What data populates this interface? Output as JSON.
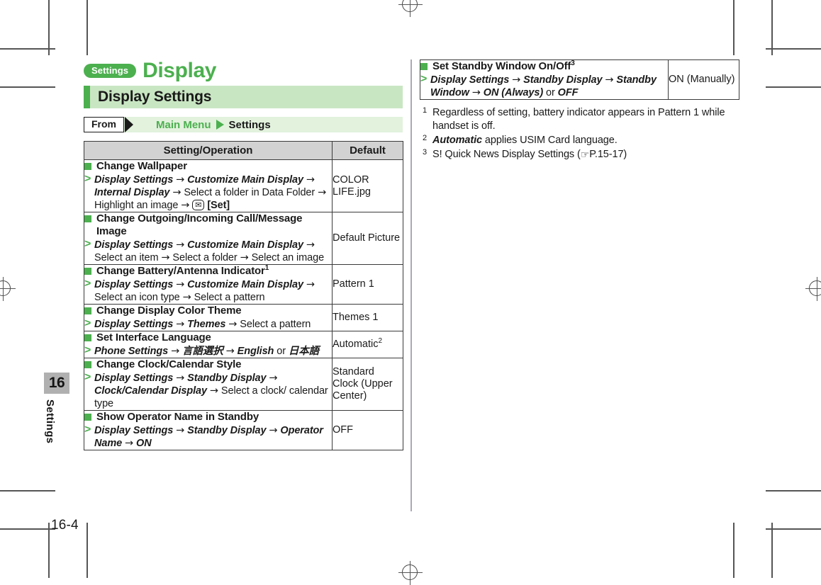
{
  "page": {
    "folio": "16-4",
    "side_tab_number": "16",
    "side_tab_label": "Settings"
  },
  "header": {
    "badge": "Settings",
    "title": "Display",
    "section_title": "Display Settings"
  },
  "breadcrumb": {
    "from_label": "From",
    "first": "Main Menu",
    "second": "Settings"
  },
  "table": {
    "columns": [
      "Setting/Operation",
      "Default"
    ],
    "rows": [
      {
        "title": "Change Wallpaper",
        "title_footnote": "",
        "steps": [
          {
            "text": "Display Settings",
            "style": "bi"
          },
          {
            "text": "→",
            "style": "arrow"
          },
          {
            "text": "Customize Main Display",
            "style": "bi"
          },
          {
            "text": "→",
            "style": "arrow"
          },
          {
            "text": "Internal Display",
            "style": "bi"
          },
          {
            "text": "→",
            "style": "arrow"
          },
          {
            "text": "Select a folder in Data Folder",
            "style": "plain"
          },
          {
            "text": "→",
            "style": "arrow"
          },
          {
            "text": "Highlight an image",
            "style": "plain"
          },
          {
            "text": "→",
            "style": "arrow"
          },
          {
            "text": "envelope-key",
            "style": "key"
          },
          {
            "text": "[Set]",
            "style": "bold"
          }
        ],
        "default": "COLOR LIFE.jpg"
      },
      {
        "title": "Change Outgoing/Incoming Call/Message Image",
        "title_footnote": "",
        "steps": [
          {
            "text": "Display Settings",
            "style": "bi"
          },
          {
            "text": "→",
            "style": "arrow"
          },
          {
            "text": "Customize Main Display",
            "style": "bi"
          },
          {
            "text": "→",
            "style": "arrow"
          },
          {
            "text": "Select an item",
            "style": "plain"
          },
          {
            "text": "→",
            "style": "arrow"
          },
          {
            "text": "Select a folder",
            "style": "plain"
          },
          {
            "text": "→",
            "style": "arrow"
          },
          {
            "text": "Select an image",
            "style": "plain"
          }
        ],
        "default": "Default Picture"
      },
      {
        "title": "Change Battery/Antenna Indicator",
        "title_footnote": "1",
        "steps": [
          {
            "text": "Display Settings",
            "style": "bi"
          },
          {
            "text": "→",
            "style": "arrow"
          },
          {
            "text": "Customize Main Display",
            "style": "bi"
          },
          {
            "text": "→",
            "style": "arrow"
          },
          {
            "text": "Select an icon type",
            "style": "plain"
          },
          {
            "text": "→",
            "style": "arrow"
          },
          {
            "text": "Select a pattern",
            "style": "plain"
          }
        ],
        "default": "Pattern 1"
      },
      {
        "title": "Change Display Color Theme",
        "title_footnote": "",
        "steps": [
          {
            "text": "Display Settings",
            "style": "bi"
          },
          {
            "text": "→",
            "style": "arrow"
          },
          {
            "text": "Themes",
            "style": "bi"
          },
          {
            "text": "→",
            "style": "arrow"
          },
          {
            "text": "Select a pattern",
            "style": "plain"
          }
        ],
        "default": "Themes 1"
      },
      {
        "title": "Set Interface Language",
        "title_footnote": "",
        "steps": [
          {
            "text": "Phone Settings",
            "style": "bi"
          },
          {
            "text": "→",
            "style": "arrow"
          },
          {
            "text": "言語選択",
            "style": "bi"
          },
          {
            "text": "→",
            "style": "arrow"
          },
          {
            "text": "English",
            "style": "bi"
          },
          {
            "text": "or",
            "style": "plain"
          },
          {
            "text": "日本語",
            "style": "bi"
          }
        ],
        "default": "Automatic",
        "default_footnote": "2"
      },
      {
        "title": "Change Clock/Calendar Style",
        "title_footnote": "",
        "steps": [
          {
            "text": "Display Settings",
            "style": "bi"
          },
          {
            "text": "→",
            "style": "arrow"
          },
          {
            "text": "Standby Display",
            "style": "bi"
          },
          {
            "text": "→",
            "style": "arrow"
          },
          {
            "text": "Clock/Calendar Display",
            "style": "bi"
          },
          {
            "text": "→",
            "style": "arrow"
          },
          {
            "text": "Select a clock/ calendar type",
            "style": "plain"
          }
        ],
        "default": "Standard Clock (Upper Center)"
      },
      {
        "title": "Show Operator Name in Standby",
        "title_footnote": "",
        "steps": [
          {
            "text": "Display Settings",
            "style": "bi"
          },
          {
            "text": "→",
            "style": "arrow"
          },
          {
            "text": "Standby Display",
            "style": "bi"
          },
          {
            "text": "→",
            "style": "arrow"
          },
          {
            "text": "Operator Name",
            "style": "bi"
          },
          {
            "text": "→",
            "style": "arrow"
          },
          {
            "text": "ON",
            "style": "bi"
          }
        ],
        "default": "OFF"
      }
    ]
  },
  "table_right": {
    "rows": [
      {
        "title": "Set Standby Window On/Off",
        "title_footnote": "3",
        "steps": [
          {
            "text": "Display Settings",
            "style": "bi"
          },
          {
            "text": "→",
            "style": "arrow"
          },
          {
            "text": "Standby Display",
            "style": "bi"
          },
          {
            "text": "→",
            "style": "arrow"
          },
          {
            "text": "Standby Window",
            "style": "bi"
          },
          {
            "text": "→",
            "style": "arrow"
          },
          {
            "text": "ON (Always)",
            "style": "bi"
          },
          {
            "text": "or",
            "style": "plain"
          },
          {
            "text": "OFF",
            "style": "bi"
          }
        ],
        "default": "ON (Manually)"
      }
    ]
  },
  "footnotes": [
    {
      "marker": "1",
      "text": "Regardless of setting, battery indicator appears in Pattern 1 while handset is off."
    },
    {
      "marker": "2",
      "text": "Automatic applies USIM Card language.",
      "lead_bold": "Automatic",
      "rest": " applies USIM Card language."
    },
    {
      "marker": "3",
      "text": "S! Quick News Display Settings (☞P.15-17)",
      "lead": "S! Quick News Display Settings (",
      "ref": "P.15-17",
      "tail": ")"
    }
  ],
  "colors": {
    "green": "#4cb04f",
    "light_green": "#c9e6c3",
    "pale_green": "#e2f2dd",
    "header_gray": "#d2d2d2",
    "tab_gray": "#b0b0b0"
  }
}
